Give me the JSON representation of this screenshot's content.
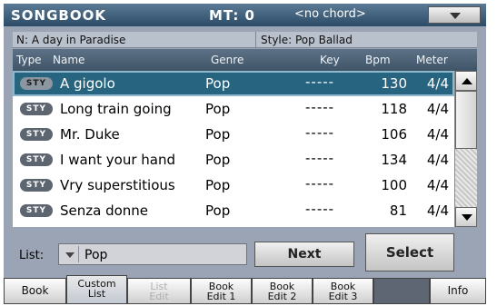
{
  "header": {
    "title": "SONGBOOK",
    "mt": "MT: 0",
    "chord": "<no chord>"
  },
  "info": {
    "song": "N: A day in Paradise",
    "style": "Style: Pop Ballad"
  },
  "columns": {
    "type": "Type",
    "name": "Name",
    "genre": "Genre",
    "key": "Key",
    "bpm": "Bpm",
    "meter": "Meter"
  },
  "rows": [
    {
      "type": "STY",
      "name": "A gigolo",
      "genre": "Pop",
      "key": "-----",
      "bpm": "130",
      "meter": "4/4",
      "selected": true
    },
    {
      "type": "STY",
      "name": "Long train going",
      "genre": "Pop",
      "key": "-----",
      "bpm": "118",
      "meter": "4/4"
    },
    {
      "type": "STY",
      "name": "Mr. Duke",
      "genre": "Pop",
      "key": "-----",
      "bpm": "106",
      "meter": "4/4"
    },
    {
      "type": "STY",
      "name": "I want your hand",
      "genre": "Pop",
      "key": "-----",
      "bpm": "134",
      "meter": "4/4"
    },
    {
      "type": "STY",
      "name": "Vry superstitious",
      "genre": "Pop",
      "key": "-----",
      "bpm": "100",
      "meter": "4/4"
    },
    {
      "type": "STY",
      "name": "Senza donne",
      "genre": "Pop",
      "key": "-----",
      "bpm": "81",
      "meter": "4/4"
    }
  ],
  "controls": {
    "list_label": "List:",
    "list_value": "Pop",
    "next_label": "Next",
    "select_label": "Select"
  },
  "tabs": {
    "book": "Book",
    "custom_list_1": "Custom",
    "custom_list_2": "List",
    "list_edit_1": "List",
    "list_edit_2": "Edit",
    "book_edit1_1": "Book",
    "book_edit1_2": "Edit 1",
    "book_edit2_1": "Book",
    "book_edit2_2": "Edit 2",
    "book_edit3_1": "Book",
    "book_edit3_2": "Edit 3",
    "info": "Info"
  },
  "colors": {
    "selected_row": "#27647f",
    "header_bar": "#2c4b67",
    "panel_bg": "#9aa4b4"
  }
}
